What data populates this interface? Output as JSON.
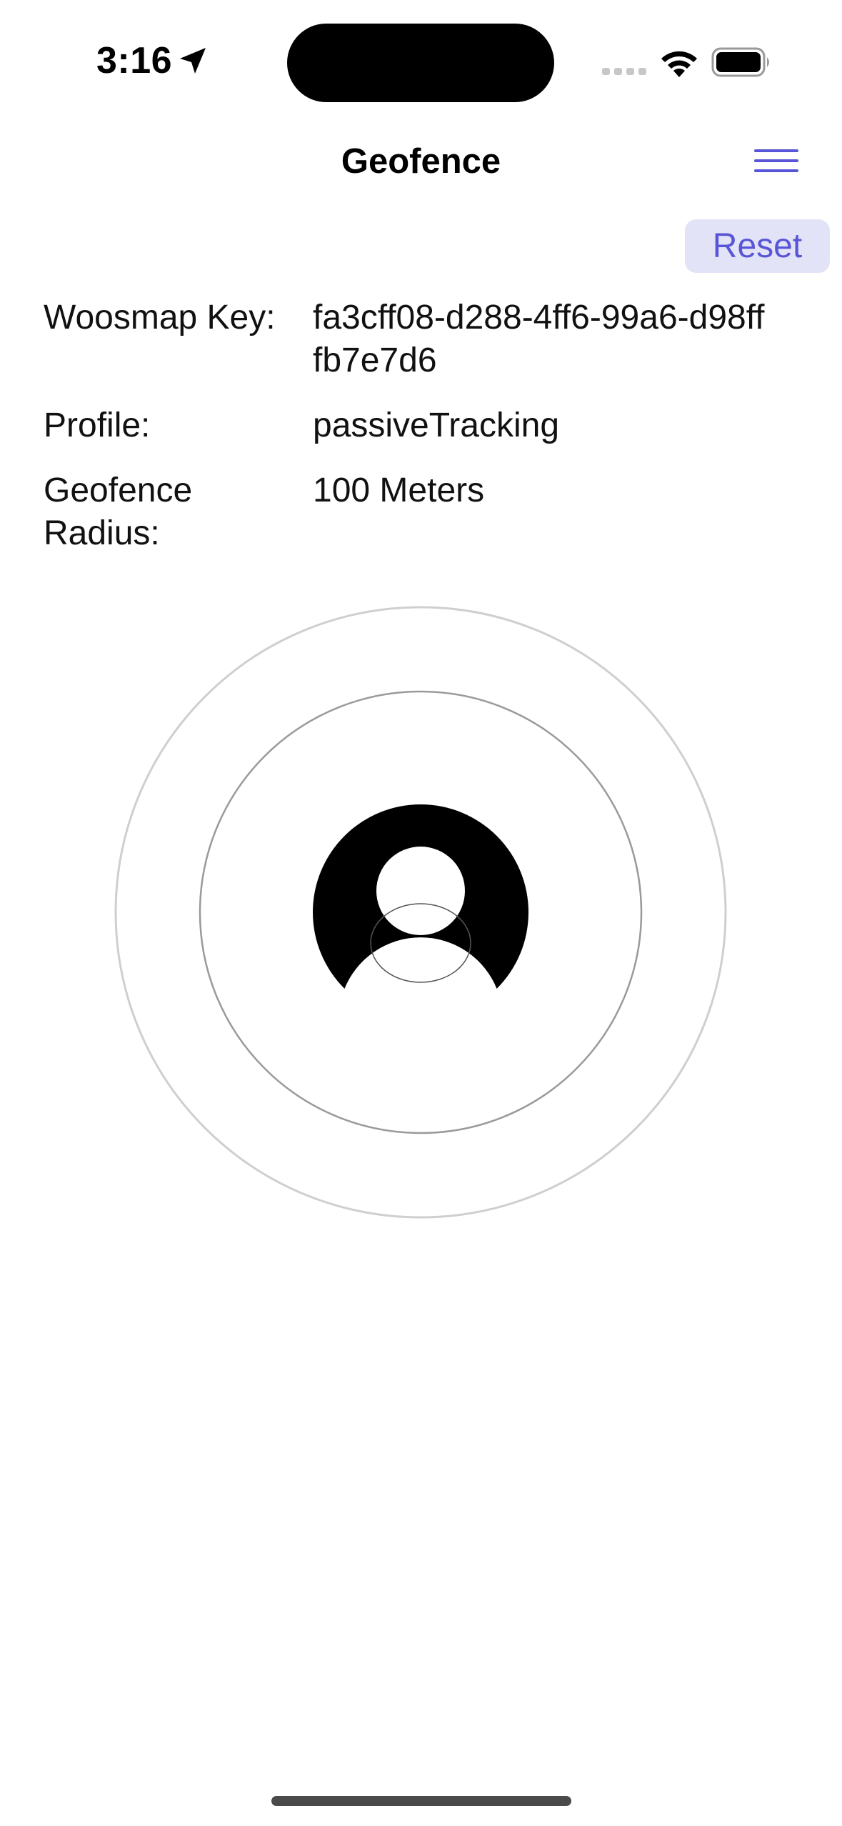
{
  "status_bar": {
    "time": "3:16",
    "location_icon": "location-arrow-icon",
    "signal_icon": "cellular-signal-icon",
    "wifi_icon": "wifi-icon",
    "battery_icon": "battery-full-icon"
  },
  "nav": {
    "title": "Geofence",
    "menu_icon": "hamburger-menu-icon",
    "accent_color": "#5856d6"
  },
  "actions": {
    "reset_label": "Reset"
  },
  "info": {
    "woosmap_key_label": "Woosmap Key:",
    "woosmap_key_value": "fa3cff08-d288-4ff6-99a6-d98fffb7e7d6",
    "profile_label": "Profile:",
    "profile_value": "passiveTracking",
    "radius_label": "Geofence Radius:",
    "radius_value": "100 Meters"
  },
  "graphic": {
    "icon": "user-avatar-icon",
    "outer_ring_color": "#cfcfcf",
    "inner_ring_color": "#9a9a9a"
  }
}
